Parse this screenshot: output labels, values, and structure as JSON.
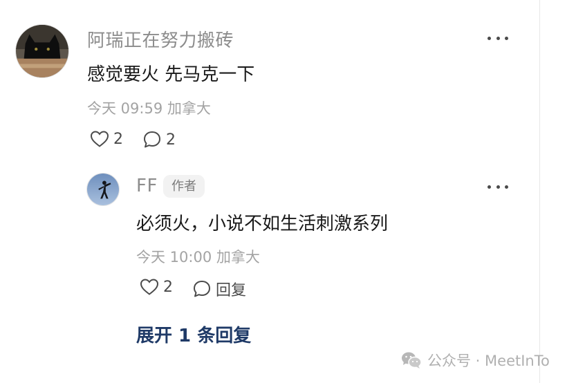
{
  "comments": [
    {
      "author": "阿瑞正在努力搬砖",
      "text": "感觉要火 先马克一下",
      "meta": "今天 09:59 加拿大",
      "likes": "2",
      "comments": "2",
      "avatar_icon": "black-cat-avatar"
    }
  ],
  "replies": [
    {
      "author": "FF",
      "badge": "作者",
      "text": "必须火，小说不如生活刺激系列",
      "meta": "今天 10:00 加拿大",
      "likes": "2",
      "reply_label": "回复",
      "avatar_icon": "silhouette-avatar"
    }
  ],
  "expand_label": "展开 1 条回复",
  "watermark": "公众号 · MeetInTo",
  "colors": {
    "link": "#1f3a67",
    "muted": "#8c8c8c",
    "text": "#1a1a1a"
  }
}
